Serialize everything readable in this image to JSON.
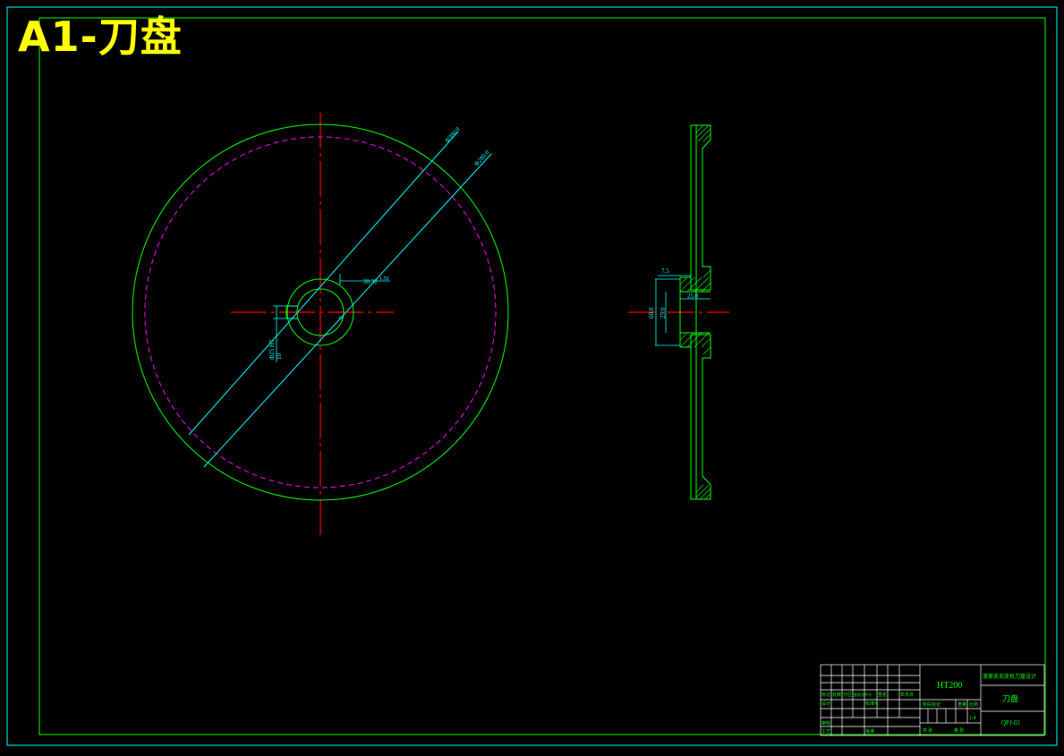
{
  "drawing": {
    "title": "A1-刀盘",
    "front_view": {
      "dim_outer_diameter": "Φ300.0",
      "dim_pitch_diameter": "Φ280.0",
      "dim_keyway_width": "30.32",
      "dim_small_1": "1.50",
      "dim_small_2": "8",
      "dim_bore_note": "Φ25 H7",
      "dim_keyway_side": "10"
    },
    "section_view": {
      "dim_hub_width": "7.5",
      "dim_bore_length": "25.0",
      "dim_hub_diameter": "60.0",
      "dim_bore_diameter": "25.0"
    },
    "title_block": {
      "material": "HT200",
      "project_name": "菠萝皮去皮机刀盘设计",
      "part_name": "刀盘",
      "drawing_number": "QPJ-02",
      "scale": "1:4",
      "labels": {
        "mark": "标记",
        "count": "处数",
        "zone": "分区",
        "change_doc": "更改文件号",
        "signature": "签名",
        "date": "年月日",
        "design": "设计",
        "standardization": "标准化",
        "review": "审核",
        "process": "工艺",
        "approve": "批准",
        "stage_mark": "阶段标记",
        "weight": "重量",
        "ratio": "比例",
        "sheet_total": "共 张",
        "sheet_no": "第 张"
      }
    },
    "colors": {
      "frame": "#00ffff",
      "inner_border": "#00ff00",
      "outline": "#00ff00",
      "center_line": "#ff0000",
      "hidden_circle": "#ff00ff",
      "dimension": "#00ffff",
      "title": "#ffff00",
      "table_lines": "#ffffff"
    }
  }
}
